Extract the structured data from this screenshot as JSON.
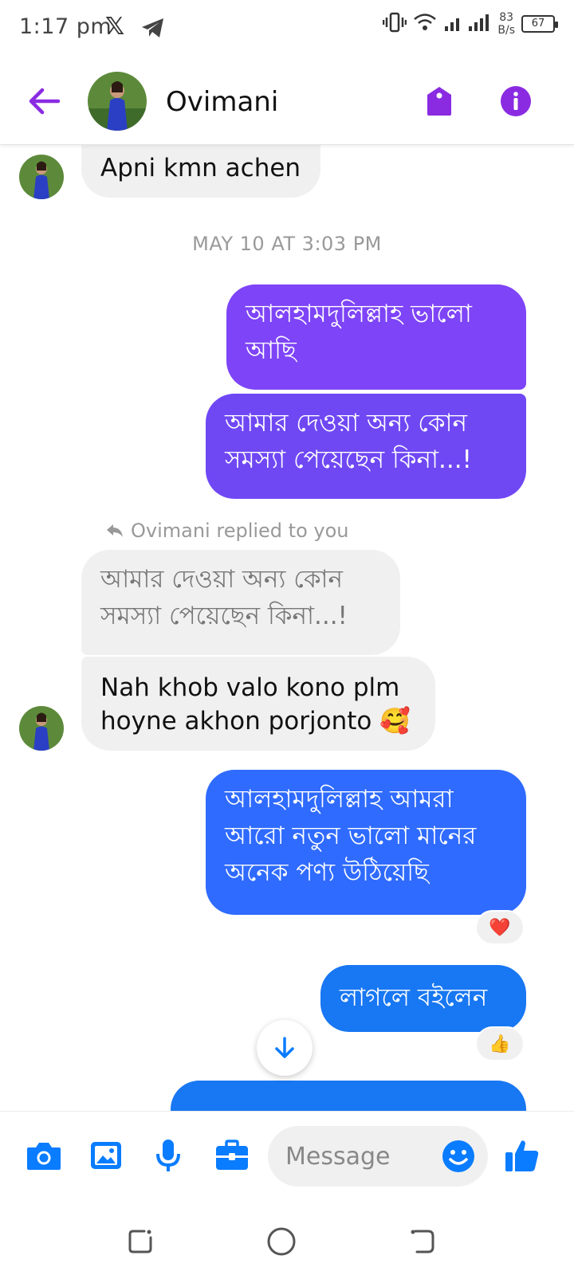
{
  "status_bar": {
    "time": "1:17 pm",
    "net_speed_value": "83",
    "net_speed_unit": "B/s",
    "battery": "67"
  },
  "header": {
    "contact_name": "Ovimani"
  },
  "messages": {
    "m1_text": "Apni kmn achen",
    "timestamp": "MAY 10 AT 3:03 PM",
    "m2_text": "আলহামদুলিল্লাহ ভালো আছি",
    "m3_text": "আমার দেওয়া অন্য কোন সমস্যা পেয়েছেন কিনা...!",
    "reply_note": "Ovimani replied to you",
    "quoted_text": "আমার দেওয়া অন্য কোন সমস্যা পেয়েছেন কিনা...!",
    "m4_text": "Nah khob valo kono plm hoyne akhon porjonto 🥰",
    "m5_text": "আলহামদুলিল্লাহ আমরা আরো নতুন ভালো মানের অনেক পণ্য উঠিয়েছি",
    "m5_reaction": "❤️",
    "m6_text": "লাগলে বইলেন",
    "m6_reaction": "👍"
  },
  "composer": {
    "placeholder": "Message"
  },
  "colors": {
    "purple_accent": "#8a2be2",
    "bubble_purple": "#7e44f7",
    "bubble_violet": "#6f48f4",
    "bubble_blue": "#2f6bff",
    "bubble_blue2": "#1877f2",
    "icon_blue": "#0a7cff"
  }
}
